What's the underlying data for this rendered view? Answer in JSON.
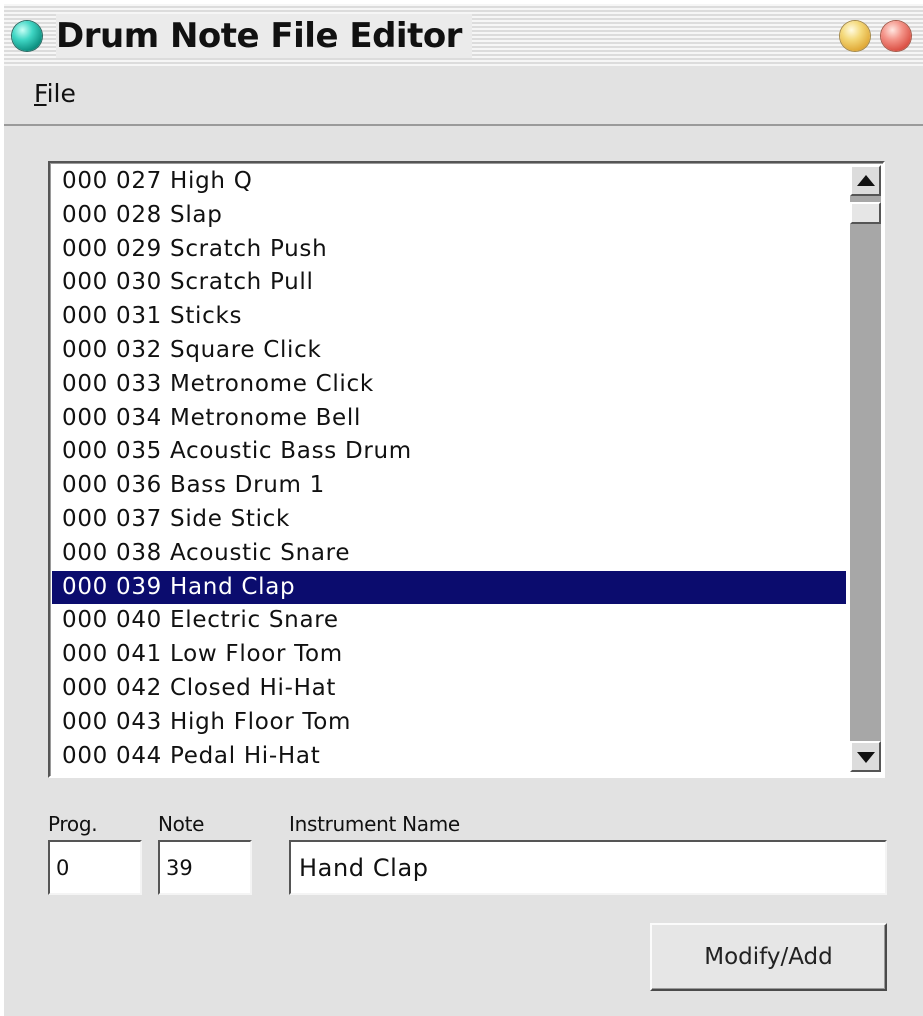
{
  "window": {
    "title": "Drum Note File Editor"
  },
  "menubar": {
    "file_mnemonic": "F",
    "file_rest": "ile"
  },
  "list": {
    "selected_index": 12,
    "items": [
      "000 027 High Q",
      "000 028 Slap",
      "000 029 Scratch Push",
      "000 030 Scratch Pull",
      "000 031 Sticks",
      "000 032 Square Click",
      "000 033 Metronome Click",
      "000 034 Metronome Bell",
      "000 035 Acoustic Bass Drum",
      "000 036 Bass Drum 1",
      "000 037 Side Stick",
      "000 038 Acoustic Snare",
      "000 039 Hand Clap",
      "000 040 Electric Snare",
      "000 041 Low Floor Tom",
      "000 042 Closed Hi-Hat",
      "000 043 High Floor Tom",
      "000 044 Pedal Hi-Hat"
    ]
  },
  "form": {
    "prog_label": "Prog.",
    "prog_value": "0",
    "note_label": "Note",
    "note_value": "39",
    "name_label": "Instrument Name",
    "name_value": "Hand Clap",
    "modify_add_label": "Modify/Add"
  },
  "colors": {
    "selection_bg": "#0b0c6e",
    "window_bg": "#e2e2e2"
  }
}
